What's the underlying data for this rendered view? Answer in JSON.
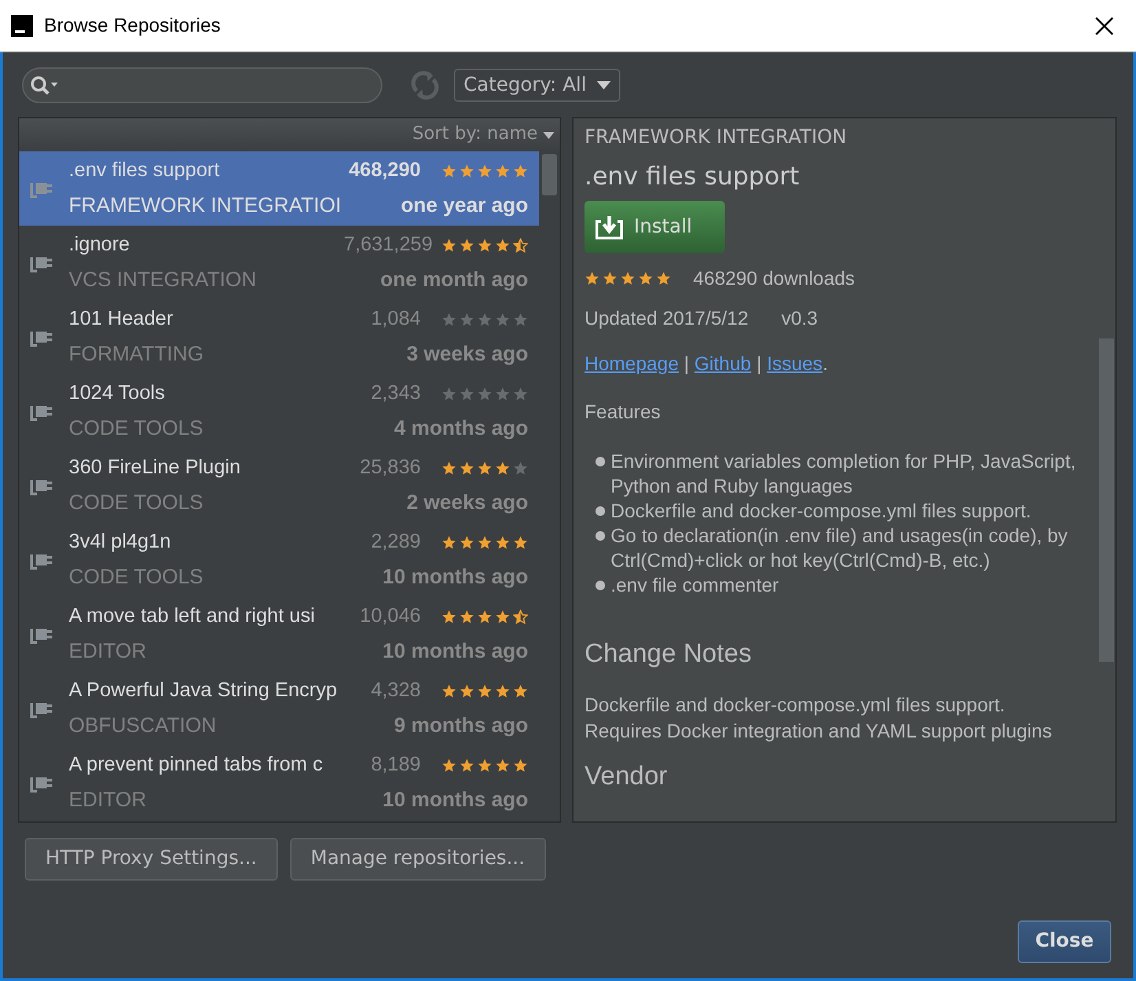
{
  "window": {
    "title": "Browse Repositories"
  },
  "toolbar": {
    "category": "Category: All"
  },
  "sort": {
    "label": "Sort by: name"
  },
  "plugins": [
    {
      "name": ".env files support",
      "downloads": "468,290",
      "stars": 5,
      "category": "FRAMEWORK INTEGRATIOI",
      "updated": "one year ago",
      "selected": true
    },
    {
      "name": ".ignore",
      "downloads": "7,631,259",
      "stars": 4.5,
      "category": "VCS INTEGRATION",
      "updated": "one month ago",
      "selected": false
    },
    {
      "name": "101 Header",
      "downloads": "1,084",
      "stars": 0,
      "category": "FORMATTING",
      "updated": "3 weeks ago",
      "selected": false
    },
    {
      "name": "1024 Tools",
      "downloads": "2,343",
      "stars": 0,
      "category": "CODE TOOLS",
      "updated": "4 months ago",
      "selected": false
    },
    {
      "name": "360 FireLine Plugin",
      "downloads": "25,836",
      "stars": 4,
      "category": "CODE TOOLS",
      "updated": "2 weeks ago",
      "selected": false
    },
    {
      "name": "3v4l pl4g1n",
      "downloads": "2,289",
      "stars": 5,
      "category": "CODE TOOLS",
      "updated": "10 months ago",
      "selected": false
    },
    {
      "name": "A move tab left and right usi",
      "downloads": "10,046",
      "stars": 4.5,
      "category": "EDITOR",
      "updated": "10 months ago",
      "selected": false
    },
    {
      "name": "A Powerful Java String Encryp",
      "downloads": "4,328",
      "stars": 5,
      "category": "OBFUSCATION",
      "updated": "9 months ago",
      "selected": false
    },
    {
      "name": "A prevent pinned tabs from c",
      "downloads": "8,189",
      "stars": 5,
      "category": "EDITOR",
      "updated": "10 months ago",
      "selected": false
    }
  ],
  "details": {
    "category": "FRAMEWORK INTEGRATION",
    "name": ".env files support",
    "install": "Install",
    "stars": 5,
    "downloads": "468290 downloads",
    "updated": "Updated 2017/5/12",
    "version": "v0.3",
    "links": [
      "Homepage",
      "Github",
      "Issues"
    ],
    "link_separator": "|",
    "links_end": ".",
    "features_title": "Features",
    "features": [
      "Environment variables completion for PHP, JavaScript, Python and Ruby languages",
      "Dockerfile and docker-compose.yml files support.",
      "Go to declaration(in .env file) and usages(in code), by Ctrl(Cmd)+click or hot key(Ctrl(Cmd)-B, etc.)",
      ".env file commenter"
    ],
    "change_notes_title": "Change Notes",
    "change_notes": [
      "Dockerfile and docker-compose.yml files support.",
      "Requires Docker integration and YAML support plugins"
    ],
    "vendor_title": "Vendor"
  },
  "buttons": [
    "HTTP Proxy Settings...",
    "Manage repositories..."
  ],
  "close": "Close"
}
